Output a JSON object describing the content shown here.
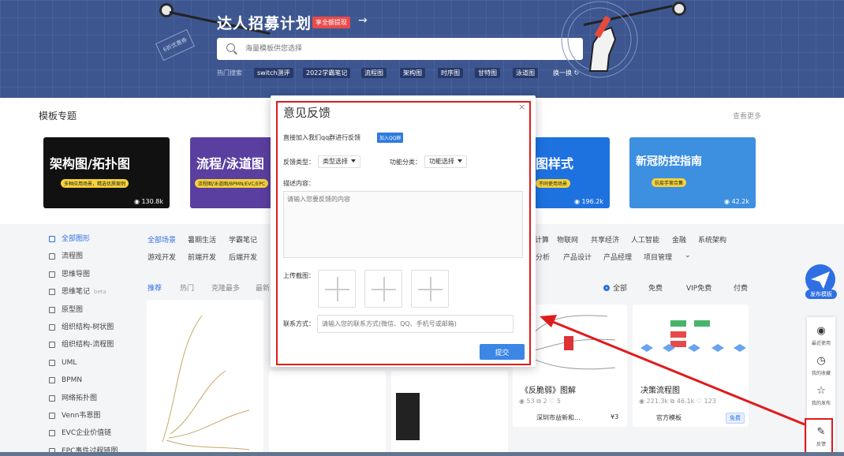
{
  "hero": {
    "title": "达人招募计划",
    "badge": "享全额提现",
    "arrow": "→",
    "stamp": "6折优惠券",
    "search_placeholder": "海量模板供您选择",
    "hot_label": "热门搜索",
    "hot_tags": [
      "switch测评",
      "2022学霸笔记",
      "流程图",
      "架构图",
      "时序图",
      "甘特图",
      "泳道图",
      "换一换 ↻"
    ]
  },
  "section": {
    "title": "模板专题",
    "see_more": "查看更多",
    "cards": [
      {
        "title": "架构图/拓扑图",
        "subtitle": "多种应用场景，精选优质案例",
        "views": "◉ 130.8k",
        "color": "#111111"
      },
      {
        "title": "流程/泳道图",
        "subtitle": "流程图/泳道图/BPMN/EVC/EPC",
        "views": "",
        "color": "#5b3fa0"
      },
      {
        "title": "图样式",
        "subtitle": "不同使用场景",
        "views": "◉ 196.2k",
        "color": "#1e72e0"
      },
      {
        "title": "新冠防控指南",
        "subtitle": "抗疫手案合集",
        "views": "◉ 42.2k",
        "color": "#3d8fe0"
      }
    ]
  },
  "sidebar": {
    "items": [
      {
        "label": "全部图形",
        "beta": ""
      },
      {
        "label": "流程图",
        "beta": ""
      },
      {
        "label": "思维导图",
        "beta": ""
      },
      {
        "label": "思维笔记",
        "beta": "beta"
      },
      {
        "label": "原型图",
        "beta": ""
      },
      {
        "label": "组织结构-树状图",
        "beta": ""
      },
      {
        "label": "组织结构-流程图",
        "beta": ""
      },
      {
        "label": "UML",
        "beta": ""
      },
      {
        "label": "BPMN",
        "beta": ""
      },
      {
        "label": "网络拓扑图",
        "beta": ""
      },
      {
        "label": "Venn韦恩图",
        "beta": ""
      },
      {
        "label": "EVC企业价值链",
        "beta": ""
      },
      {
        "label": "EPC事件过程链图",
        "beta": ""
      }
    ]
  },
  "categories": {
    "row1_left": [
      "全部场景",
      "暑期生活",
      "学霸笔记"
    ],
    "row1_right": [
      "计算",
      "物联网",
      "共享经济",
      "人工智能",
      "金融",
      "系统架构"
    ],
    "row2_left": [
      "游戏开发",
      "前端开发",
      "后端开发"
    ],
    "row2_right": [
      "分析",
      "产品设计",
      "产品经理",
      "项目管理",
      "⌄"
    ]
  },
  "tabs": [
    "推荐",
    "热门",
    "克隆最多",
    "最新"
  ],
  "filters": [
    "全部",
    "免费",
    "VIP免费",
    "付费"
  ],
  "templates": [
    {
      "name": "《反脆弱》图解",
      "stats": "◉ 53  ⧉ 2  ♡ 5",
      "author": "深圳市益新和...",
      "price": "¥3"
    },
    {
      "name": "决策流程图",
      "stats": "◉ 221.3k  ⧉ 46.1k  ♡ 123",
      "author": "官方模板",
      "price": "免费"
    }
  ],
  "floatbar": {
    "publish": "发布模板",
    "items": [
      "最近使用",
      "我的收藏",
      "我的发布",
      "反馈"
    ]
  },
  "modal": {
    "title": "意见反馈",
    "close": "×",
    "qq_text": "直接加入我们qq群进行反馈",
    "qq_button": "加入QQ群",
    "type_label": "反馈类型：",
    "type_select": "类型选择",
    "func_label": "功能分类：",
    "func_select": "功能选择",
    "desc_label": "描述内容：",
    "desc_placeholder": "请输入您要反馈的内容",
    "upload_label": "上传截图：",
    "contact_label": "联系方式：",
    "contact_placeholder": "请输入您的联系方式(微信、QQ、手机号或邮箱)",
    "submit": "提交"
  }
}
